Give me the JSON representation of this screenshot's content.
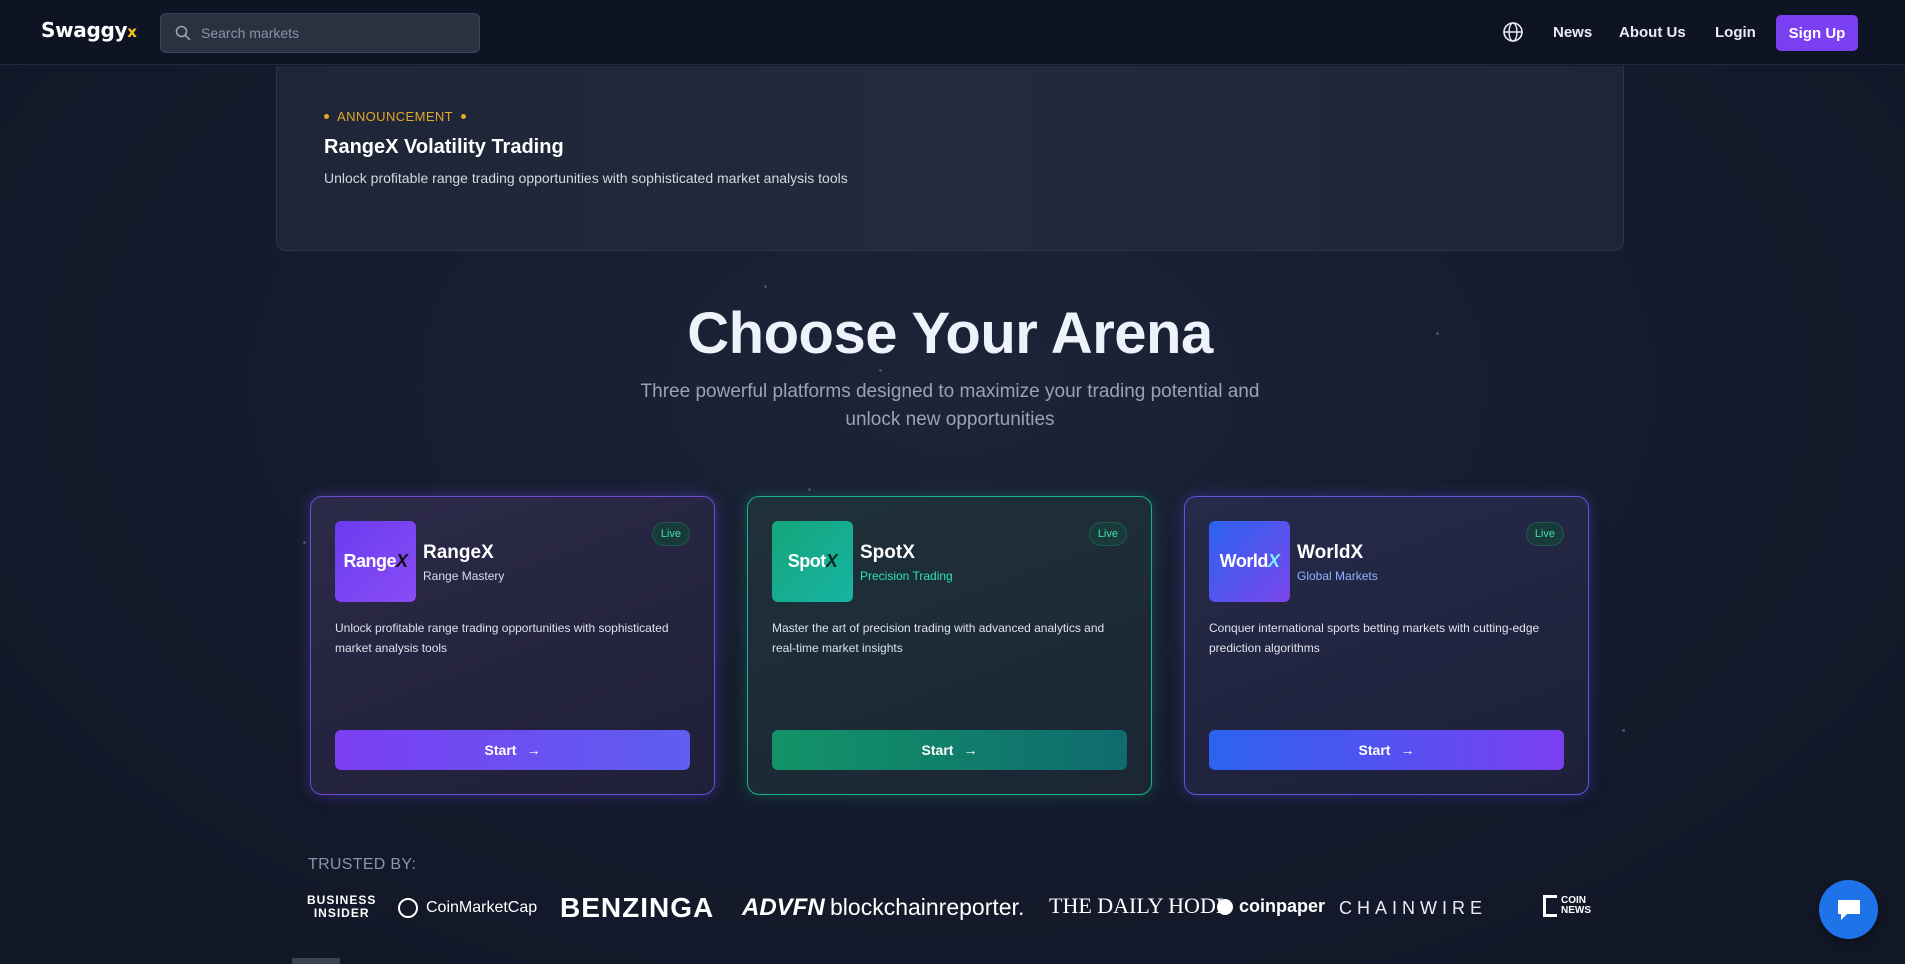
{
  "header": {
    "logo_text": "Swaggy",
    "logo_accent": "x",
    "search_placeholder": "Search markets",
    "nav": {
      "news": "News",
      "about": "About Us",
      "login": "Login",
      "signup": "Sign Up"
    }
  },
  "announcement": {
    "tag": "ANNOUNCEMENT",
    "title": "RangeX Volatility Trading",
    "description": "Unlock profitable range trading opportunities with sophisticated market analysis tools"
  },
  "hero": {
    "title": "Choose Your Arena",
    "subtitle": "Three powerful platforms designed to maximize your trading potential and unlock new opportunities"
  },
  "cards": [
    {
      "icon_text": "Range",
      "icon_accent": "X",
      "name": "RangeX",
      "tagline": "Range Mastery",
      "status": "Live",
      "description": "Unlock profitable range trading opportunities with sophisticated market analysis tools",
      "button": "Start",
      "arrow": "→"
    },
    {
      "icon_text": "Spot",
      "icon_accent": "X",
      "name": "SpotX",
      "tagline": "Precision Trading",
      "status": "Live",
      "description": "Master the art of precision trading with advanced analytics and real-time market insights",
      "button": "Start",
      "arrow": "→"
    },
    {
      "icon_text": "World",
      "icon_accent": "X",
      "name": "WorldX",
      "tagline": "Global Markets",
      "status": "Live",
      "description": "Conquer international sports betting markets with cutting-edge prediction algorithms",
      "button": "Start",
      "arrow": "→"
    }
  ],
  "trusted": {
    "label": "TRUSTED BY:",
    "logos": {
      "business_insider_1": "BUSINESS",
      "business_insider_2": "INSIDER",
      "coinmarketcap": "CoinMarketCap",
      "benzinga": "BENZINGA",
      "advfn": "ADVFN",
      "blockchainreporter": "blockchainreporter.",
      "dailyhodl": "THE DAILY HODL",
      "coinpaper": "coinpaper",
      "chainwire": "CHAINWIRE",
      "coinnews_1": "COIN",
      "coinnews_2": "NEWS"
    }
  },
  "colors": {
    "accent_purple": "#7b3ff2",
    "accent_green": "#17b48a",
    "accent_blue": "#2b63f0",
    "announcement": "#e2a92a",
    "chat": "#1f73e8"
  },
  "icons": [
    "search-icon",
    "globe-icon",
    "chat-icon",
    "arrow-right-icon"
  ]
}
